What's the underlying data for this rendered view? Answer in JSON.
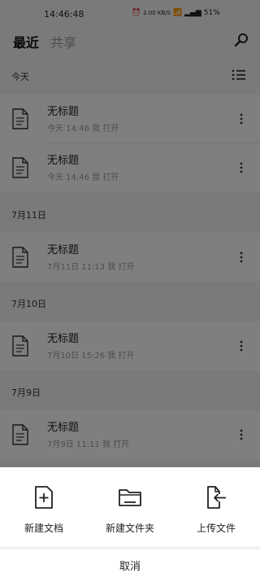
{
  "status_bar": {
    "time": "14:46:48",
    "net_speed": "2.00 KB/S",
    "battery": "51%"
  },
  "tabs": {
    "recent": "最近",
    "shared": "共享"
  },
  "sections": [
    {
      "label": "今天",
      "files": [
        {
          "title": "无标题",
          "meta": "今天 14:46 我 打开"
        },
        {
          "title": "无标题",
          "meta": "今天 14:46 我 打开"
        }
      ]
    },
    {
      "label": "7月11日",
      "files": [
        {
          "title": "无标题",
          "meta": "7月11日 11:13 我 打开"
        }
      ]
    },
    {
      "label": "7月10日",
      "files": [
        {
          "title": "无标题",
          "meta": "7月10日 15:26 我 打开"
        }
      ]
    },
    {
      "label": "7月9日",
      "files": [
        {
          "title": "无标题",
          "meta": "7月9日 11:11 我 打开"
        }
      ]
    }
  ],
  "sheet": {
    "new_doc": "新建文档",
    "new_folder": "新建文件夹",
    "upload": "上传文件",
    "cancel": "取消"
  }
}
